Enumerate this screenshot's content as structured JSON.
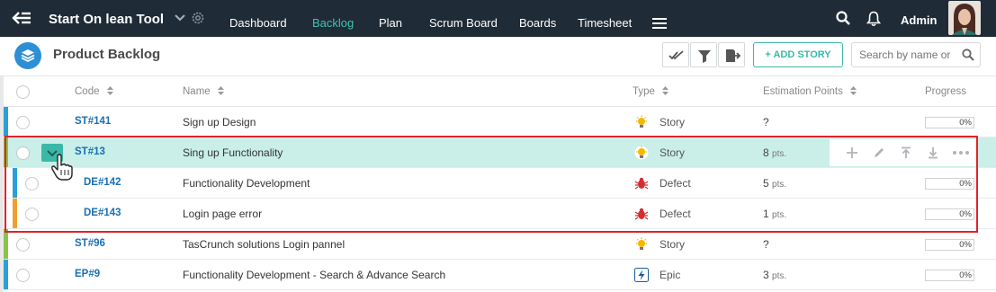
{
  "app": {
    "title": "Start On lean Tool",
    "user": "Admin"
  },
  "nav": [
    "Dashboard",
    "Backlog",
    "Plan",
    "Scrum Board",
    "Boards",
    "Timesheet"
  ],
  "nav_active": "Backlog",
  "page": {
    "title": "Product Backlog",
    "add_story": "+ ADD STORY",
    "search_placeholder": "Search by name or"
  },
  "columns": {
    "code": "Code",
    "name": "Name",
    "type": "Type",
    "estimation": "Estimation Points",
    "progress": "Progress"
  },
  "rows": [
    {
      "code": "ST#141",
      "name": "Sign up Design",
      "type": "Story",
      "type_icon": "bulb-icon",
      "est": "?",
      "pts": "",
      "progress": "0%",
      "bar": "#2a9fd8"
    },
    {
      "code": "ST#13",
      "name": "Sing up Functionality",
      "type": "Story",
      "type_icon": "bulb-icon",
      "est": "8",
      "pts": "pts.",
      "progress": "0%",
      "bar": "#8bc34a"
    },
    {
      "code": "DE#142",
      "name": "Functionality Development",
      "type": "Defect",
      "type_icon": "bug-icon",
      "est": "5",
      "pts": "pts.",
      "progress": "0%",
      "bar": "#2a9fd8"
    },
    {
      "code": "DE#143",
      "name": "Login page error",
      "type": "Defect",
      "type_icon": "bug-icon",
      "est": "1",
      "pts": "pts.",
      "progress": "0%",
      "bar": "#f0a030"
    },
    {
      "code": "ST#96",
      "name": "TasCrunch solutions Login pannel",
      "type": "Story",
      "type_icon": "bulb-icon",
      "est": "?",
      "pts": "",
      "progress": "0%",
      "bar": "#8bc34a"
    },
    {
      "code": "EP#9",
      "name": "Functionality Development - Search & Advance Search",
      "type": "Epic",
      "type_icon": "lightning-icon",
      "est": "3",
      "pts": "pts.",
      "progress": "0%",
      "bar": "#2a9fd8"
    }
  ],
  "colors": {
    "nav_bg": "#1f2b36",
    "accent": "#3cb8a8",
    "link": "#1b6fb3",
    "highlight": "#e0222a",
    "selected_row": "#c9efe8"
  }
}
